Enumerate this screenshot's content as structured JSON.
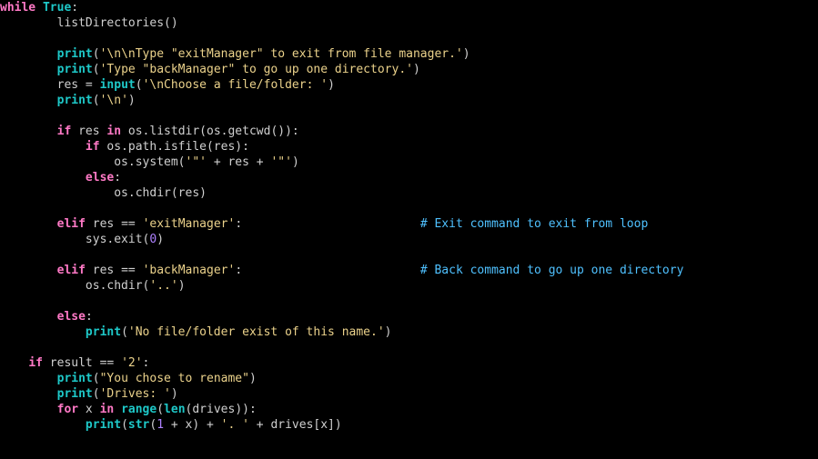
{
  "code": {
    "l1": {
      "kw": "while",
      "sp": " ",
      "btin": "True",
      "colon": ":"
    },
    "l2": {
      "indent": "        ",
      "txt": "listDirectories()"
    },
    "l3": {
      "indent": "        ",
      "btin": "print",
      "open": "(",
      "str": "'\\n\\nType \"exitManager\" to exit from file manager.'",
      "close": ")"
    },
    "l4": {
      "indent": "        ",
      "btin": "print",
      "open": "(",
      "str": "'Type \"backManager\" to go up one directory.'",
      "close": ")"
    },
    "l5": {
      "indent": "        ",
      "lhs": "res = ",
      "btin": "input",
      "open": "(",
      "str": "'\\nChoose a file/folder: '",
      "close": ")"
    },
    "l6": {
      "indent": "        ",
      "btin": "print",
      "open": "(",
      "str": "'\\n'",
      "close": ")"
    },
    "l7": {
      "indent": "        ",
      "kw1": "if",
      "mid1": " res ",
      "kw2": "in",
      "mid2": " os.listdir(os.getcwd()):"
    },
    "l8": {
      "indent": "            ",
      "kw": "if",
      "rest": " os.path.isfile(res):"
    },
    "l9": {
      "indent": "                ",
      "pre": "os.system(",
      "s1": "'\"'",
      "mid": " + res + ",
      "s2": "'\"'",
      "close": ")"
    },
    "l10": {
      "indent": "            ",
      "kw": "else",
      "colon": ":"
    },
    "l11": {
      "indent": "                ",
      "txt": "os.chdir(res)"
    },
    "l12": {
      "indent": "        ",
      "kw": "elif",
      "mid": " res == ",
      "str": "'exitManager'",
      "colon": ":",
      "pad": "                         ",
      "cmt": "# Exit command to exit from loop"
    },
    "l13": {
      "indent": "            ",
      "pre": "sys.exit(",
      "num": "0",
      "close": ")"
    },
    "l14": {
      "indent": "        ",
      "kw": "elif",
      "mid": " res == ",
      "str": "'backManager'",
      "colon": ":",
      "pad": "                         ",
      "cmt": "# Back command to go up one directory"
    },
    "l15": {
      "indent": "            ",
      "pre": "os.chdir(",
      "str": "'..'",
      "close": ")"
    },
    "l16": {
      "indent": "        ",
      "kw": "else",
      "colon": ":"
    },
    "l17": {
      "indent": "            ",
      "btin": "print",
      "open": "(",
      "str": "'No file/folder exist of this name.'",
      "close": ")"
    },
    "l18": {
      "indent": "    ",
      "kw": "if",
      "mid": " result == ",
      "str": "'2'",
      "colon": ":"
    },
    "l19": {
      "indent": "        ",
      "btin": "print",
      "open": "(",
      "str": "\"You chose to rename\"",
      "close": ")"
    },
    "l20": {
      "indent": "        ",
      "btin": "print",
      "open": "(",
      "str": "'Drives: '",
      "close": ")"
    },
    "l21": {
      "indent": "        ",
      "kw1": "for",
      "mid1": " x ",
      "kw2": "in",
      "sp": " ",
      "btin1": "range",
      "open1": "(",
      "btin2": "len",
      "open2": "(drives)):"
    },
    "l22": {
      "indent": "            ",
      "btin1": "print",
      "open": "(",
      "btin2": "str",
      "open2": "(",
      "num": "1",
      "mid1": " + x) + ",
      "str1": "'. '",
      "mid2": " + drives[x])"
    }
  }
}
